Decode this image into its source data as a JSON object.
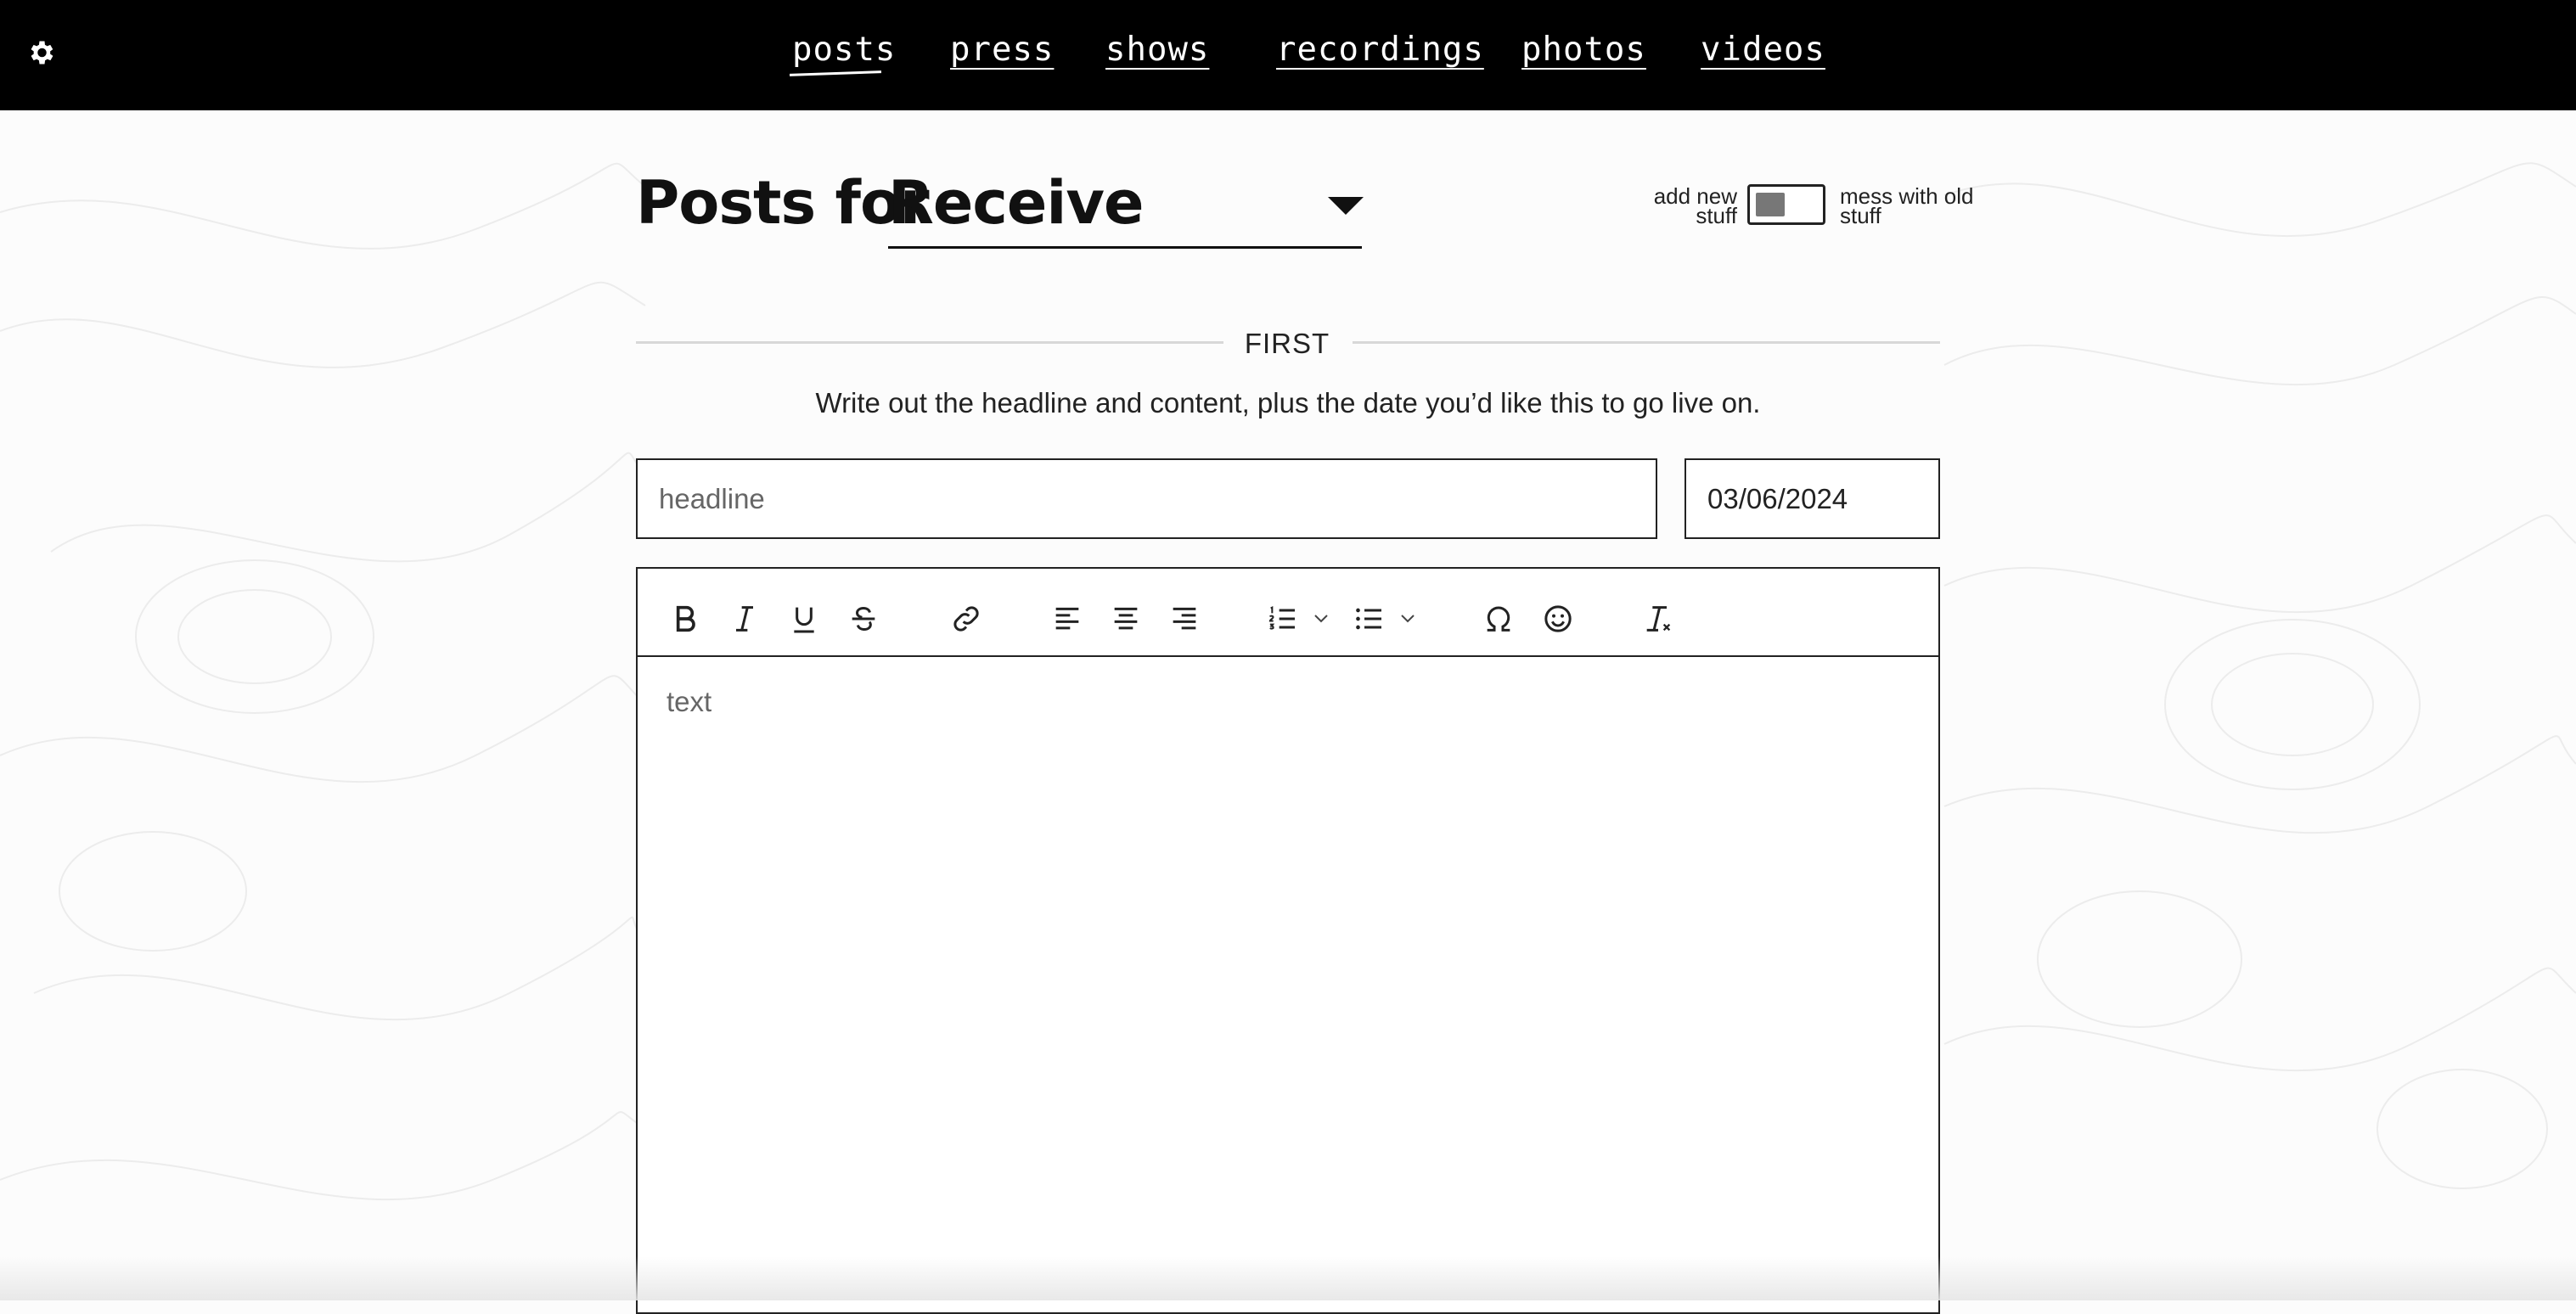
{
  "nav": {
    "settings_icon": "gear-icon",
    "items": [
      {
        "label": "posts",
        "active": true
      },
      {
        "label": "press"
      },
      {
        "label": "shows"
      },
      {
        "label": "recordings"
      },
      {
        "label": "photos"
      },
      {
        "label": "videos"
      }
    ]
  },
  "page": {
    "title_prefix": "Posts for",
    "band_select": {
      "value": "Receive"
    },
    "mode_toggle": {
      "left_label": "add new stuff",
      "right_label": "mess with old stuff",
      "state": "add new stuff"
    }
  },
  "section": {
    "label": "FIRST",
    "instructions": "Write out the headline and content, plus the date you’d like this to go live on."
  },
  "form": {
    "headline": {
      "placeholder": "headline",
      "value": ""
    },
    "date": {
      "value": "03/06/2024"
    },
    "editor": {
      "placeholder": "text",
      "toolbar": [
        "bold-icon",
        "italic-icon",
        "underline-icon",
        "strikethrough-icon",
        "link-icon",
        "align-left-icon",
        "align-center-icon",
        "align-right-icon",
        "numbered-list-icon",
        "bullet-list-icon",
        "special-character-icon",
        "emoji-icon",
        "clear-formatting-icon"
      ]
    }
  },
  "colors": {
    "navbar": "#000000",
    "page_background": "#fcfcfc",
    "text": "#111111",
    "divider": "#d8d8d8",
    "toggle_knob": "#777777"
  }
}
